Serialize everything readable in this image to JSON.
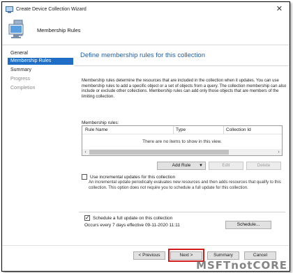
{
  "window": {
    "title": "Create Device Collection Wizard"
  },
  "banner": {
    "title": "Membership Rules"
  },
  "nav": {
    "items": [
      {
        "label": "General",
        "state": "normal"
      },
      {
        "label": "Membership Rules",
        "state": "active"
      },
      {
        "label": "Summary",
        "state": "normal"
      },
      {
        "label": "Progress",
        "state": "disabled"
      },
      {
        "label": "Completion",
        "state": "disabled"
      }
    ]
  },
  "main": {
    "heading": "Define membership rules for this collection",
    "description": "Membership rules determine the resources that are included in the collection when it updates. You can use membership rules to add a specific object or a set of objects from a query. The collection membership can also include or exclude other collections. Membership rules can add only those objects that are members of the limiting collection.",
    "rules_label": "Membership rules:",
    "grid": {
      "columns": [
        "Rule Name",
        "Type",
        "Collection Id"
      ],
      "empty_message": "There are no items to show in this view."
    },
    "buttons": {
      "add_rule": "Add Rule",
      "edit": "Edit",
      "delete": "Delete"
    },
    "incremental": {
      "label": "Use incremental updates for this collection",
      "checked": false,
      "description": "An incremental update periodically evaluates new resources and then adds resources that qualify to this collection. This option does not require you to schedule a full update for this collection."
    },
    "schedule": {
      "label": "Schedule a full update on this collection",
      "checked": true,
      "summary": "Occurs every 7 days effective 09-11-2020 11:11",
      "button": "Schedule..."
    }
  },
  "footer": {
    "previous": "< Previous",
    "next": "Next >",
    "summary": "Summary",
    "cancel": "Cancel"
  },
  "watermark": "MSFTnotCORE",
  "colors": {
    "accent": "#1f6ec5",
    "heading": "#1f5fa8",
    "highlight": "#d21c1c"
  }
}
